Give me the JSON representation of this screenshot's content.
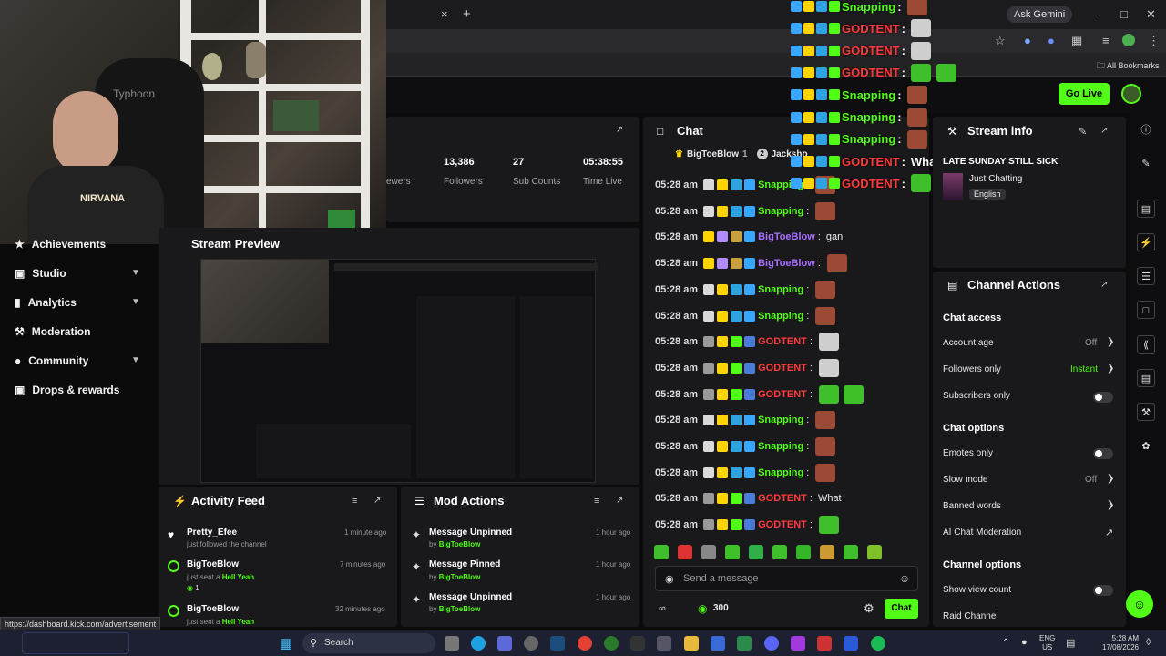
{
  "browser": {
    "tab_close": "×",
    "new_tab": "+",
    "ask_gemini": "Ask Gemini",
    "all_bookmarks": "All Bookmarks",
    "status_url": "https://dashboard.kick.com/advertisement"
  },
  "header": {
    "go_live": "Go Live"
  },
  "webcam": {
    "chair_brand": "Typhoon",
    "shirt_text": "NIRVANA"
  },
  "sidebar": {
    "items": [
      {
        "label": "Achievements"
      },
      {
        "label": "Studio"
      },
      {
        "label": "Analytics"
      },
      {
        "label": "Moderation"
      },
      {
        "label": "Community"
      },
      {
        "label": "Drops & rewards"
      }
    ]
  },
  "stats": {
    "partial_label": "ewers",
    "followers_value": "13,386",
    "followers_label": "Followers",
    "subs_value": "27",
    "subs_label": "Sub Counts",
    "time_value": "05:38:55",
    "time_label": "Time Live"
  },
  "stream_preview": {
    "title": "Stream Preview"
  },
  "activity_feed": {
    "title": "Activity Feed",
    "items": [
      {
        "name": "Pretty_Efee",
        "text": "just followed the channel",
        "time": "1 minute ago"
      },
      {
        "name": "BigToeBlow",
        "text": "just sent a",
        "gift": "Hell Yeah",
        "count": "1",
        "time": "7 minutes ago"
      },
      {
        "name": "BigToeBlow",
        "text": "just sent a",
        "gift": "Hell Yeah",
        "time": "32 minutes ago"
      }
    ]
  },
  "mod_actions": {
    "title": "Mod Actions",
    "items": [
      {
        "action": "Message Unpinned",
        "by": "by",
        "user": "BigToeBlow",
        "time": "1 hour ago"
      },
      {
        "action": "Message Pinned",
        "by": "by",
        "user": "BigToeBlow",
        "time": "1 hour ago"
      },
      {
        "action": "Message Unpinned",
        "by": "by",
        "user": "BigToeBlow",
        "time": "1 hour ago"
      }
    ]
  },
  "chat": {
    "title": "Chat",
    "pinned_1": "BigToeBlow",
    "pinned_1_count": "1",
    "pinned_2_num": "2",
    "pinned_2": "Jacksho",
    "messages": [
      {
        "time": "05:28 am",
        "user": "Snapping",
        "text": ""
      },
      {
        "time": "05:28 am",
        "user": "Snapping",
        "text": ""
      },
      {
        "time": "05:28 am",
        "user": "BigToeBlow",
        "text": "gan"
      },
      {
        "time": "05:28 am",
        "user": "BigToeBlow",
        "text": ""
      },
      {
        "time": "05:28 am",
        "user": "Snapping",
        "text": ""
      },
      {
        "time": "05:28 am",
        "user": "Snapping",
        "text": ""
      },
      {
        "time": "05:28 am",
        "user": "GODTENT",
        "text": ""
      },
      {
        "time": "05:28 am",
        "user": "GODTENT",
        "text": ""
      },
      {
        "time": "05:28 am",
        "user": "GODTENT",
        "text": ""
      },
      {
        "time": "05:28 am",
        "user": "Snapping",
        "text": ""
      },
      {
        "time": "05:28 am",
        "user": "Snapping",
        "text": ""
      },
      {
        "time": "05:28 am",
        "user": "Snapping",
        "text": ""
      },
      {
        "time": "05:28 am",
        "user": "GODTENT",
        "text": "What"
      },
      {
        "time": "05:28 am",
        "user": "GODTENT",
        "text": ""
      }
    ],
    "colon": ":",
    "placeholder": "Send a message",
    "points": "300",
    "send": "Chat"
  },
  "overlay_chat": {
    "lines": [
      {
        "user": "Snapping",
        "text": ""
      },
      {
        "user": "GODTENT",
        "text": ""
      },
      {
        "user": "GODTENT",
        "text": ""
      },
      {
        "user": "GODTENT",
        "text": ""
      },
      {
        "user": "Snapping",
        "text": ""
      },
      {
        "user": "Snapping",
        "text": ""
      },
      {
        "user": "Snapping",
        "text": ""
      },
      {
        "user": "GODTENT",
        "text": "What"
      },
      {
        "user": "GODTENT",
        "text": ""
      }
    ]
  },
  "stream_info": {
    "title": "Stream info",
    "stream_title": "LATE SUNDAY STILL SICK",
    "category": "Just Chatting",
    "language": "English"
  },
  "channel_actions": {
    "title": "Channel Actions",
    "chat_access": "Chat access",
    "account_age": "Account age",
    "account_age_val": "Off",
    "followers_only": "Followers only",
    "followers_only_val": "Instant",
    "subscribers_only": "Subscribers only",
    "chat_options": "Chat options",
    "emotes_only": "Emotes only",
    "slow_mode": "Slow mode",
    "slow_mode_val": "Off",
    "banned_words": "Banned words",
    "ai_moderation": "AI Chat Moderation",
    "channel_options": "Channel options",
    "show_view_count": "Show view count",
    "raid_channel": "Raid Channel"
  },
  "taskbar": {
    "search": "Search",
    "lang1": "ENG",
    "lang2": "US",
    "time": "5:28 AM",
    "date": "17/08/2026"
  },
  "colors": {
    "kick_green": "#53fc18",
    "godtent_red": "#ff3b3b",
    "username_purple": "#a970ff",
    "panel_bg": "#19191c"
  }
}
